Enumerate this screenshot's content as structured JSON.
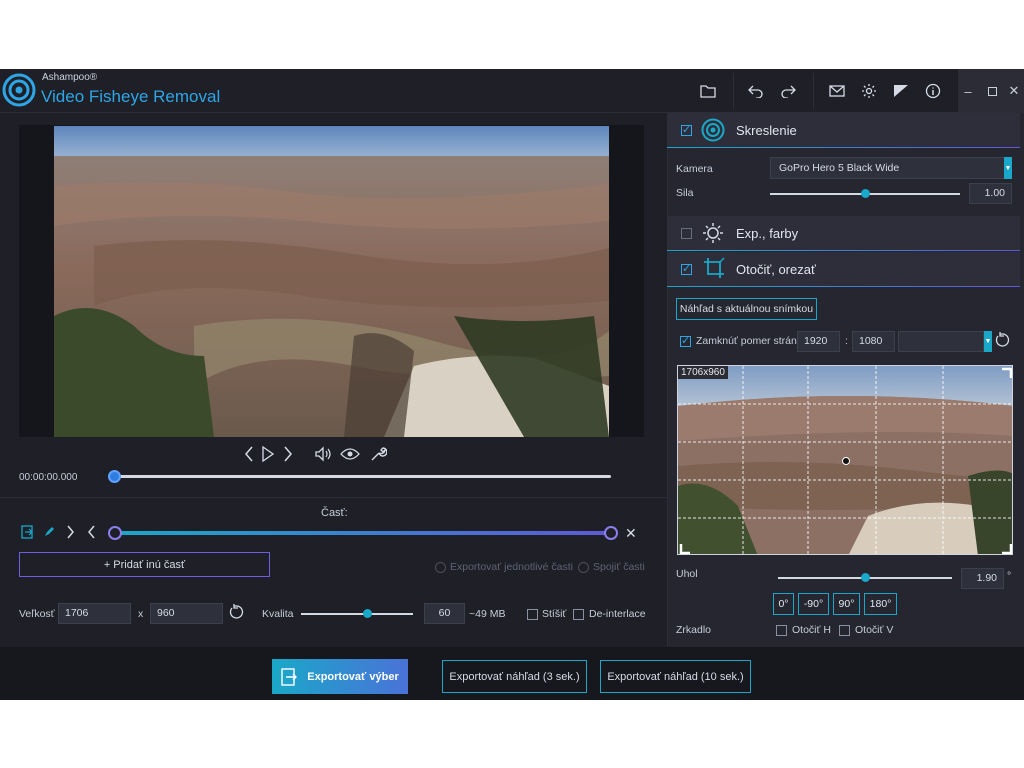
{
  "app": {
    "brand_small": "Ashampoo®",
    "brand_main": "Video Fisheye Removal",
    "accent": "#1aa8c8",
    "accent2": "#5f59d6"
  },
  "toolbar": {
    "icons": [
      "folder-icon",
      "undo-icon",
      "redo-icon",
      "mail-icon",
      "gear-icon",
      "theme-icon",
      "info-icon"
    ],
    "window": [
      "minimize",
      "maximize",
      "close"
    ]
  },
  "player": {
    "timecode": "00:00:00.000",
    "position": 0.0
  },
  "parts": {
    "label": "Časť:",
    "add_part": "+ Pridať inú časť",
    "export_individual": "Exportovať jednotlivé časti",
    "merge_parts": "Spojiť časti"
  },
  "output": {
    "size_label": "Veľkosť",
    "width": "1706",
    "times": "x",
    "height": "960",
    "quality_label": "Kvalita",
    "quality_value": "60",
    "quality_level": 0.59,
    "estimated_size": "~49 MB",
    "mute_label": "Stíšiť",
    "deinterlace_label": "De-interlace"
  },
  "footer": {
    "export_selection": "Exportovať výber",
    "export_preview_3": "Exportovať náhľad (3 sek.)",
    "export_preview_10": "Exportovať náhľad (10 sek.)"
  },
  "distortion": {
    "title": "Skreslenie",
    "enabled": true,
    "camera_label": "Kamera",
    "camera_value": "GoPro Hero 5 Black Wide",
    "strength_label": "Sila",
    "strength_value": "1.00",
    "strength_level": 0.5
  },
  "exposure": {
    "title": "Exp., farby",
    "enabled": false
  },
  "rotate": {
    "title": "Otočiť, orezať",
    "enabled": true,
    "preview_frame_button": "Náhľad s aktuálnou snímkou",
    "lock_ratio_label": "Zamknúť pomer strán",
    "lock_ratio_checked": true,
    "ratio_w": "1920",
    "ratio_sep": ":",
    "ratio_h": "1080",
    "crop_size": "1706x960",
    "angle_label": "Uhol",
    "angle_value": "1.90",
    "angle_unit": "°",
    "angle_level": 0.5,
    "angle_buttons": [
      "0°",
      "-90°",
      "90°",
      "180°"
    ],
    "mirror_label": "Zrkadlo",
    "flip_h": "Otočiť H",
    "flip_v": "Otočiť V"
  }
}
